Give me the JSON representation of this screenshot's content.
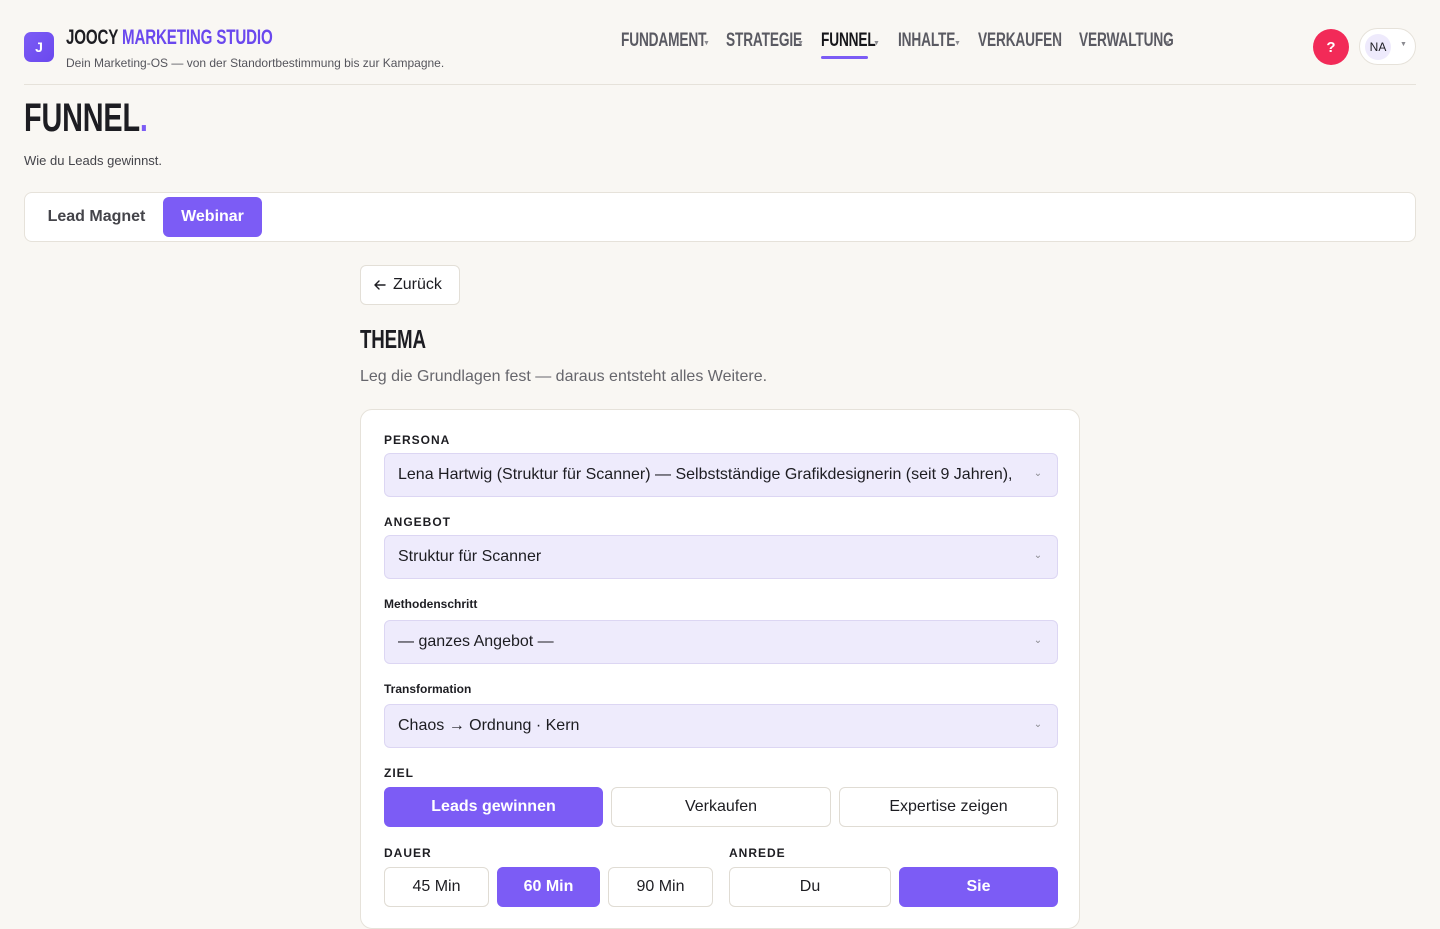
{
  "app": {
    "logo_letter": "J",
    "brand_part1": "JOOCY",
    "brand_part2": "MARKETING STUDIO",
    "tagline": "Dein Marketing-OS — von der Standortbestimmung bis zur Kampagne."
  },
  "nav": {
    "items": [
      {
        "label": "FUNDAMENT"
      },
      {
        "label": "STRATEGIE"
      },
      {
        "label": "FUNNEL"
      },
      {
        "label": "INHALTE"
      },
      {
        "label": "VERKAUFEN"
      },
      {
        "label": "VERWALTUNG"
      }
    ],
    "active": "FUNNEL"
  },
  "user": {
    "help_label": "?",
    "initials": "NA"
  },
  "page": {
    "title": "FUNNEL",
    "title_dot": ".",
    "subtitle": "Wie du Leads gewinnst."
  },
  "tabs": {
    "items": [
      {
        "label": "Lead Magnet"
      },
      {
        "label": "Webinar"
      }
    ],
    "active": "Webinar"
  },
  "content": {
    "back_label": "Zurück",
    "section_title": "THEMA",
    "section_subtitle": "Leg die Grundlagen fest — daraus entsteht alles Weitere.",
    "fields": {
      "persona": {
        "label": "PERSONA",
        "value": "Lena Hartwig (Struktur für Scanner) — Selbstständige Grafikdesignerin (seit 9 Jahren),"
      },
      "angebot": {
        "label": "ANGEBOT",
        "value": "Struktur für Scanner"
      },
      "methodenschritt": {
        "label": "Methodenschritt",
        "value": "— ganzes Angebot —"
      },
      "transformation": {
        "label": "Transformation",
        "value": "Chaos → Ordnung · Kern"
      }
    },
    "ziel": {
      "label": "ZIEL",
      "options": [
        "Leads gewinnen",
        "Verkaufen",
        "Expertise zeigen"
      ],
      "selected": "Leads gewinnen"
    },
    "dauer": {
      "label": "DAUER",
      "options": [
        "45 Min",
        "60 Min",
        "90 Min"
      ],
      "selected": "60 Min"
    },
    "anrede": {
      "label": "ANREDE",
      "options": [
        "Du",
        "Sie"
      ],
      "selected": "Sie"
    }
  },
  "colors": {
    "accent": "#7c5cf5",
    "help": "#f22a58",
    "background": "#f9f7f3",
    "select_bg": "#eeebfc"
  }
}
